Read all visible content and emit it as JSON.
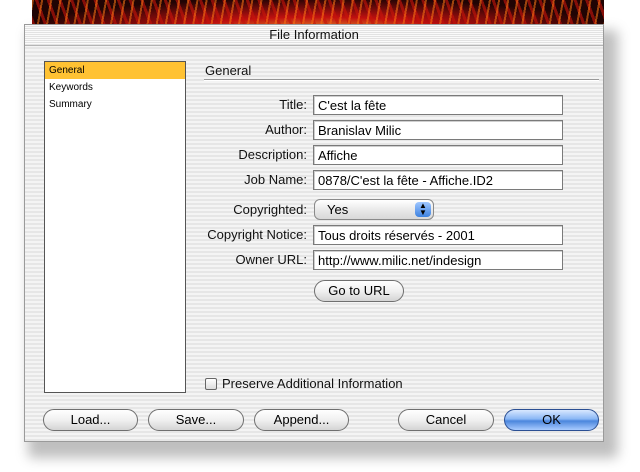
{
  "window": {
    "title": "File Information"
  },
  "sidebar": {
    "items": [
      {
        "label": "General",
        "selected": true
      },
      {
        "label": "Keywords",
        "selected": false
      },
      {
        "label": "Summary",
        "selected": false
      }
    ]
  },
  "section": {
    "title": "General"
  },
  "form": {
    "title": {
      "label": "Title:",
      "value": "C'est la fête"
    },
    "author": {
      "label": "Author:",
      "value": "Branislav Milic"
    },
    "description": {
      "label": "Description:",
      "value": "Affiche"
    },
    "job_name": {
      "label": "Job Name:",
      "value": "0878/C'est la fête - Affiche.ID2"
    },
    "copyrighted": {
      "label": "Copyrighted:",
      "value": "Yes"
    },
    "copyright_notice": {
      "label": "Copyright Notice:",
      "value": "Tous droits réservés - 2001"
    },
    "owner_url": {
      "label": "Owner URL:",
      "value": "http://www.milic.net/indesign"
    }
  },
  "go_to_url_label": "Go to URL",
  "preserve": {
    "label": "Preserve Additional Information",
    "checked": false
  },
  "buttons": {
    "load": "Load...",
    "save": "Save...",
    "append": "Append...",
    "cancel": "Cancel",
    "ok": "OK"
  },
  "colors": {
    "selection": "#ffc233",
    "default_button": "#4b86dd"
  }
}
